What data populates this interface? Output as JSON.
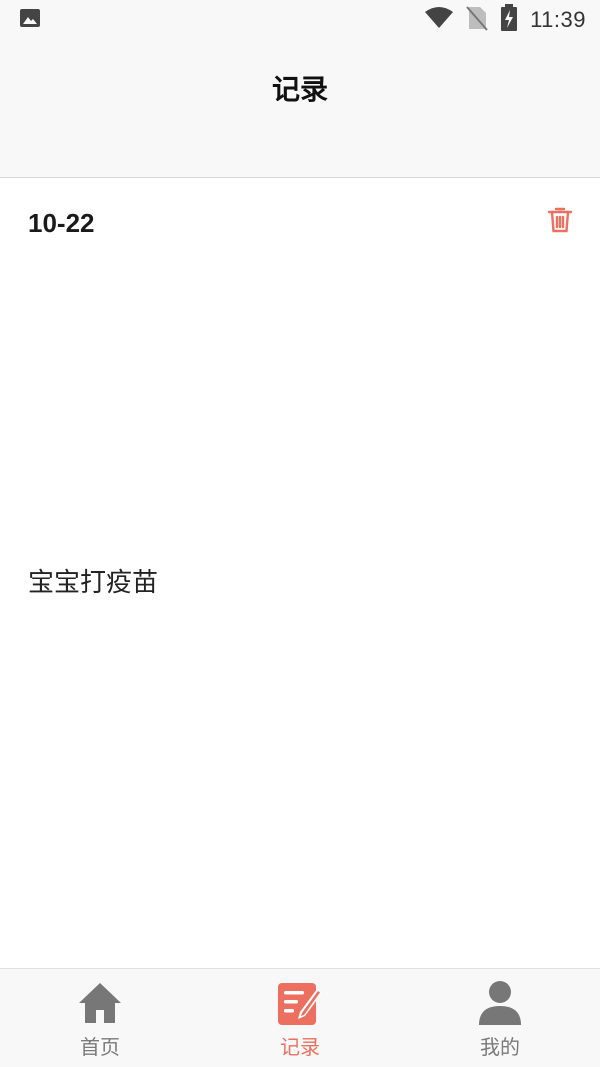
{
  "status_bar": {
    "time": "11:39"
  },
  "header": {
    "title": "记录"
  },
  "record": {
    "date": "10-22",
    "text": "宝宝打疫苗"
  },
  "bottom_nav": {
    "items": [
      {
        "label": "首页",
        "icon": "home-icon",
        "active": false
      },
      {
        "label": "记录",
        "icon": "note-edit-icon",
        "active": true
      },
      {
        "label": "我的",
        "icon": "person-icon",
        "active": false
      }
    ]
  },
  "colors": {
    "accent": "#ec6f5f",
    "inactive": "#7a7a7a",
    "bar_bg": "#f8f8f8"
  }
}
